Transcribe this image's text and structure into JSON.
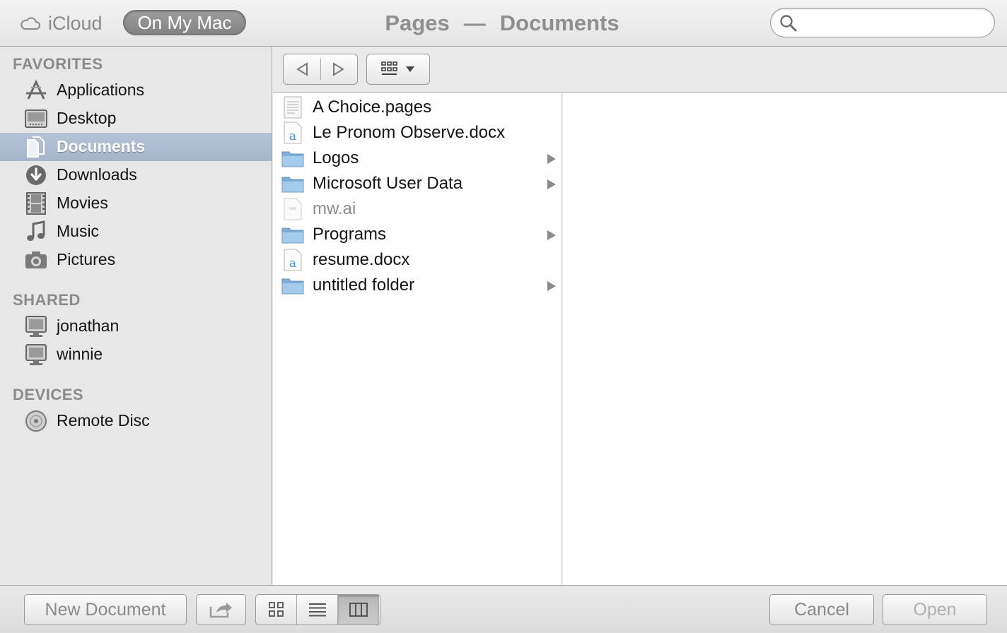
{
  "titlebar": {
    "icloud_label": "iCloud",
    "on_my_mac_label": "On My Mac",
    "app_name": "Pages",
    "separator": "—",
    "folder_name": "Documents",
    "search_placeholder": ""
  },
  "sidebar": {
    "favorites_heading": "FAVORITES",
    "favorites": [
      {
        "label": "Applications",
        "icon": "applications-icon"
      },
      {
        "label": "Desktop",
        "icon": "desktop-icon"
      },
      {
        "label": "Documents",
        "icon": "documents-icon",
        "selected": true
      },
      {
        "label": "Downloads",
        "icon": "downloads-icon"
      },
      {
        "label": "Movies",
        "icon": "movies-icon"
      },
      {
        "label": "Music",
        "icon": "music-icon"
      },
      {
        "label": "Pictures",
        "icon": "pictures-icon"
      }
    ],
    "shared_heading": "SHARED",
    "shared": [
      {
        "label": "jonathan",
        "icon": "computer-icon"
      },
      {
        "label": "winnie",
        "icon": "computer-icon"
      }
    ],
    "devices_heading": "DEVICES",
    "devices": [
      {
        "label": "Remote Disc",
        "icon": "disc-icon"
      }
    ]
  },
  "files": [
    {
      "name": "A Choice.pages",
      "type": "pages-document"
    },
    {
      "name": "Le Pronom Observe.docx",
      "type": "word-document"
    },
    {
      "name": "Logos",
      "type": "folder"
    },
    {
      "name": "Microsoft User Data",
      "type": "folder"
    },
    {
      "name": "mw.ai",
      "type": "generic-file",
      "disabled": true
    },
    {
      "name": "Programs",
      "type": "folder"
    },
    {
      "name": "resume.docx",
      "type": "word-document"
    },
    {
      "name": "untitled folder",
      "type": "folder"
    }
  ],
  "bottombar": {
    "new_document_label": "New Document",
    "cancel_label": "Cancel",
    "open_label": "Open",
    "view_mode": "columns"
  },
  "colors": {
    "selection": "#a7b5cb",
    "folder": "#8fb8dc"
  }
}
